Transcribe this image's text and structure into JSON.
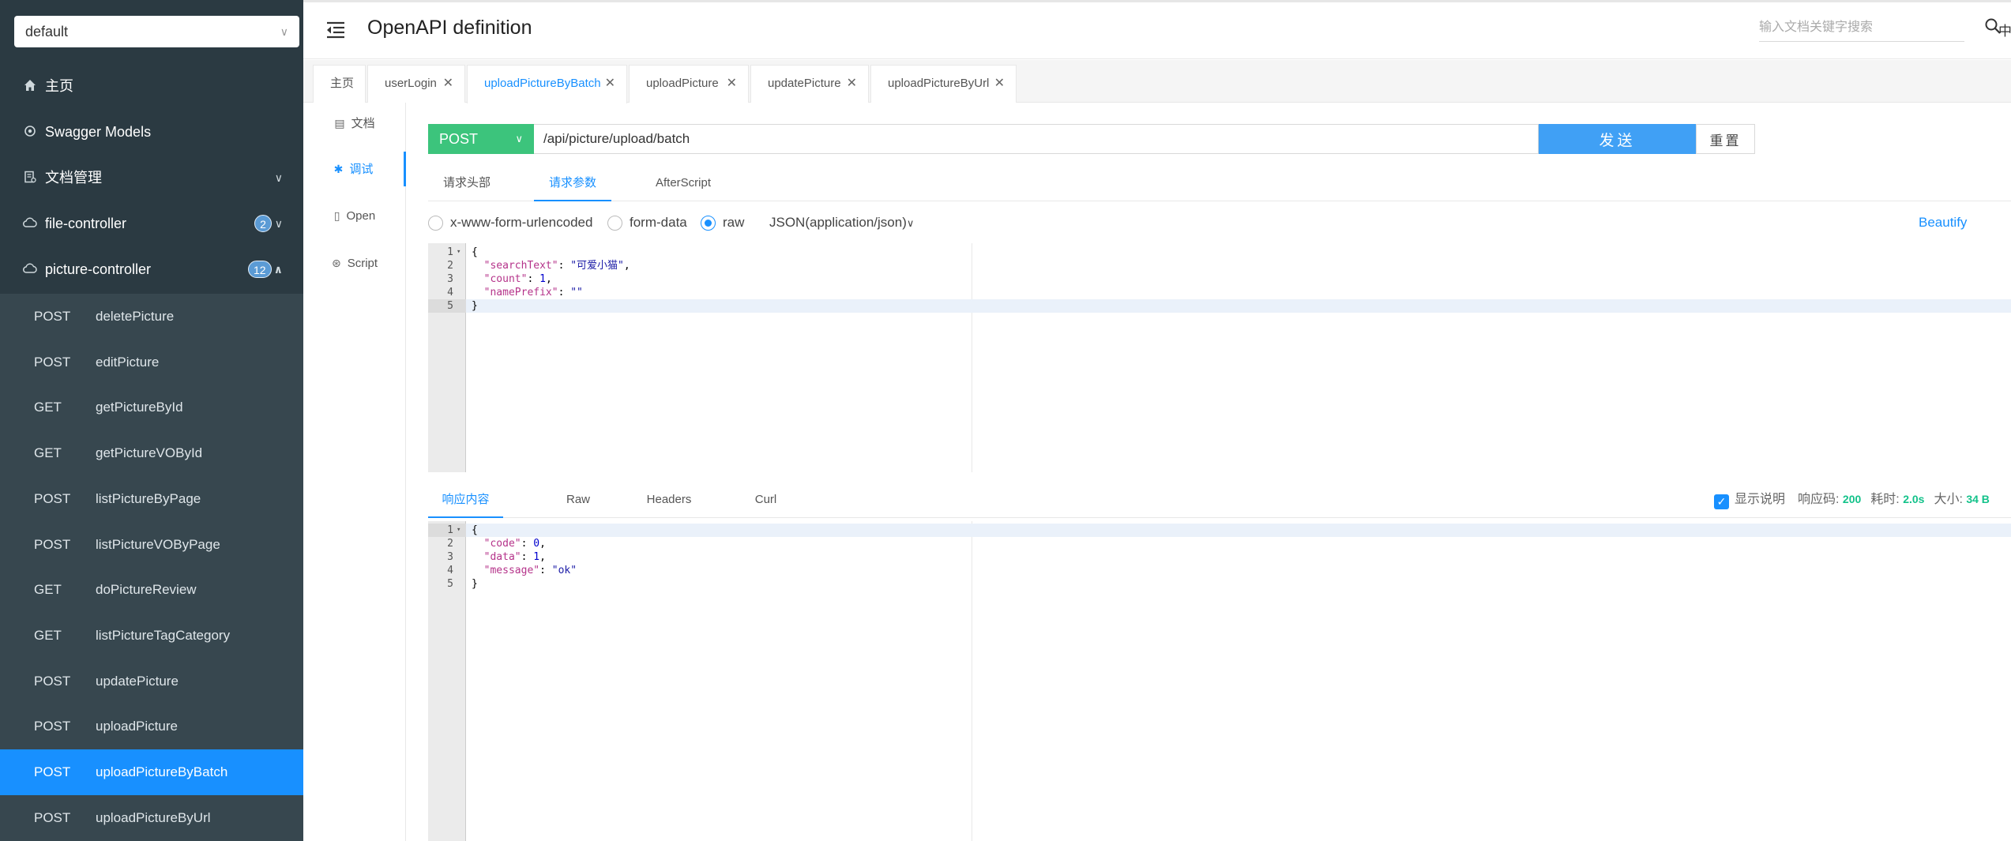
{
  "sidebar": {
    "group_value": "default",
    "items": [
      {
        "label": "主页",
        "icon": "home-icon"
      },
      {
        "label": "Swagger Models",
        "icon": "models-icon"
      },
      {
        "label": "文档管理",
        "icon": "docs-icon"
      },
      {
        "label": "file-controller",
        "icon": "cloud-icon",
        "count": "2"
      },
      {
        "label": "picture-controller",
        "icon": "cloud-icon",
        "count": "12"
      }
    ],
    "apis": [
      {
        "method": "POST",
        "name": "deletePicture"
      },
      {
        "method": "POST",
        "name": "editPicture"
      },
      {
        "method": "GET",
        "name": "getPictureById"
      },
      {
        "method": "GET",
        "name": "getPictureVOById"
      },
      {
        "method": "POST",
        "name": "listPictureByPage"
      },
      {
        "method": "POST",
        "name": "listPictureVOByPage"
      },
      {
        "method": "GET",
        "name": "doPictureReview"
      },
      {
        "method": "GET",
        "name": "listPictureTagCategory"
      },
      {
        "method": "POST",
        "name": "updatePicture"
      },
      {
        "method": "POST",
        "name": "uploadPicture"
      },
      {
        "method": "POST",
        "name": "uploadPictureByBatch",
        "active": true
      },
      {
        "method": "POST",
        "name": "uploadPictureByUrl"
      }
    ]
  },
  "header": {
    "title": "OpenAPI definition",
    "search_placeholder": "输入文档关键字搜索",
    "lang": "中"
  },
  "tabs": [
    {
      "label": "主页",
      "closable": false
    },
    {
      "label": "userLogin",
      "closable": true
    },
    {
      "label": "uploadPictureByBatch",
      "closable": true,
      "active": true
    },
    {
      "label": "uploadPicture",
      "closable": true
    },
    {
      "label": "updatePicture",
      "closable": true
    },
    {
      "label": "uploadPictureByUrl",
      "closable": true
    }
  ],
  "mini_nav": [
    {
      "label": "文档",
      "icon": "doc-icon"
    },
    {
      "label": "调试",
      "icon": "bug-icon",
      "active": true
    },
    {
      "label": "Open",
      "icon": "file-icon"
    },
    {
      "label": "Script",
      "icon": "script-icon"
    }
  ],
  "request": {
    "method": "POST",
    "url": "/api/picture/upload/batch",
    "send_label": "发送",
    "reset_label": "重置",
    "subtabs": [
      "请求头部",
      "请求参数",
      "AfterScript"
    ],
    "active_subtab": 1,
    "body_types": [
      {
        "label": "x-www-form-urlencoded",
        "checked": false
      },
      {
        "label": "form-data",
        "checked": false
      },
      {
        "label": "raw",
        "checked": true
      }
    ],
    "content_type": "JSON(application/json)",
    "beautify_label": "Beautify",
    "body_lines": [
      "{",
      "  \"searchText\": \"可爱小猫\",",
      "  \"count\": 1,",
      "  \"namePrefix\": \"\"",
      "}"
    ]
  },
  "response": {
    "tabs": [
      "响应内容",
      "Raw",
      "Headers",
      "Curl"
    ],
    "active_tab": 0,
    "show_desc_label": "显示说明",
    "show_desc_checked": true,
    "status_label": "响应码:",
    "status_value": "200",
    "time_label": "耗时:",
    "time_value": "2.0s",
    "size_label": "大小:",
    "size_value": "34 B",
    "body_lines": [
      "{",
      "  \"code\": 0,",
      "  \"data\": 1,",
      "  \"message\": \"ok\"",
      "}"
    ]
  }
}
